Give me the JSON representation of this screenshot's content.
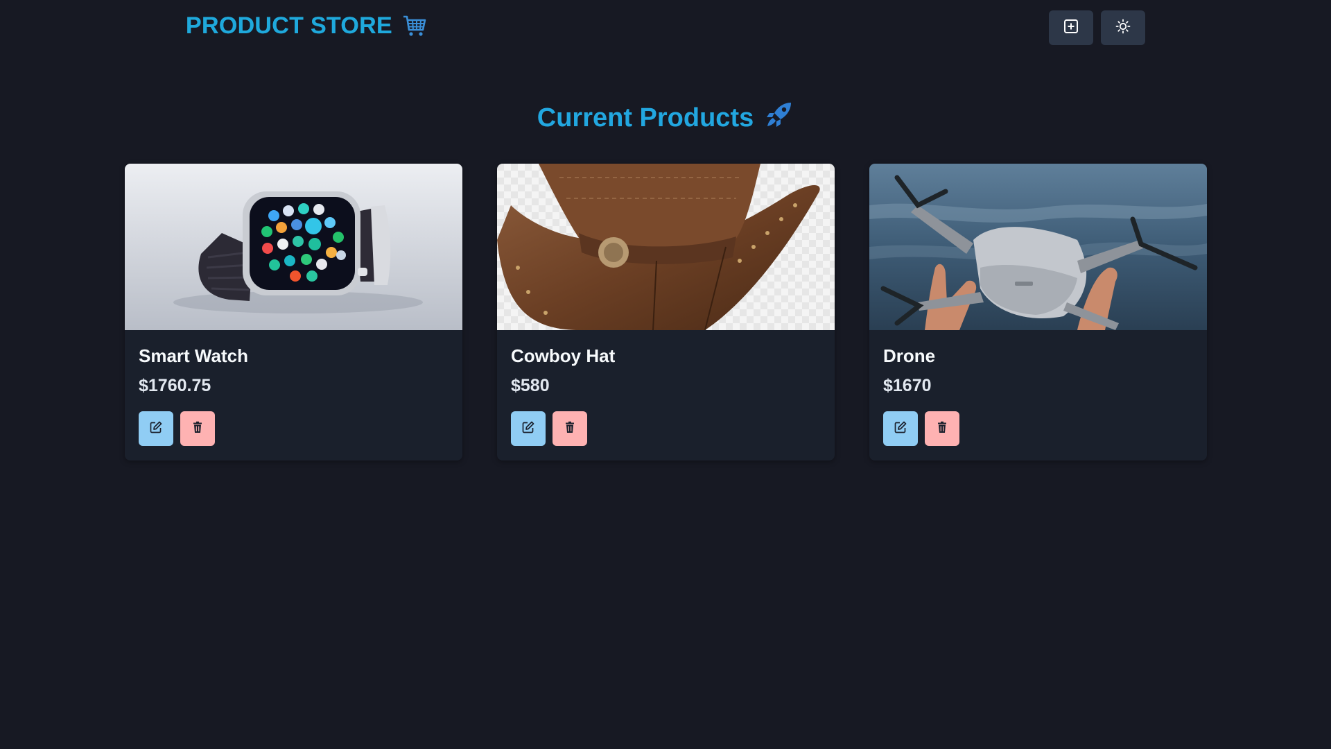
{
  "navbar": {
    "brand": "PRODUCT STORE",
    "brand_icon": "shopping-cart-icon",
    "create_icon": "plus-square-icon",
    "theme_icon": "sun-icon"
  },
  "heading": {
    "text": "Current Products",
    "icon": "rocket-icon"
  },
  "products": [
    {
      "name": "Smart Watch",
      "price": "$1760.75",
      "image": "smart-watch-photo"
    },
    {
      "name": "Cowboy Hat",
      "price": "$580",
      "image": "cowboy-hat-photo"
    },
    {
      "name": "Drone",
      "price": "$1670",
      "image": "drone-photo"
    }
  ],
  "colors": {
    "background": "#171923",
    "card": "#1a202c",
    "accent": "#1fa9dc",
    "edit_button": "#90cdf4",
    "delete_button": "#feb2b2"
  }
}
